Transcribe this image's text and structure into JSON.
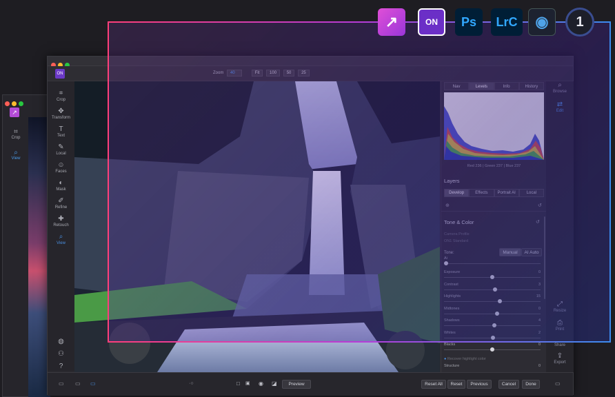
{
  "colors": {
    "accent": "#4a90e2",
    "overlay_border_start": "#ff3f7a",
    "overlay_border_end": "#3c8bf0"
  },
  "plugins": [
    {
      "name": "arrow-plugin-icon",
      "text": "↗"
    },
    {
      "name": "on1-plugin-icon",
      "text": "ON"
    },
    {
      "name": "photoshop-icon",
      "text": "Ps"
    },
    {
      "name": "lightroom-classic-icon",
      "text": "LrC"
    },
    {
      "name": "aperture-icon",
      "text": "◉"
    },
    {
      "name": "capture-one-icon",
      "text": "1"
    }
  ],
  "bg_window": {
    "tools": [
      {
        "label": "Crop",
        "icon": "crop-icon"
      },
      {
        "label": "View",
        "icon": "view-icon"
      }
    ]
  },
  "toolbar": {
    "zoom_label": "Zoom",
    "zoom_value": "40",
    "fit": "Fit",
    "z100": "100",
    "z50": "50",
    "z25": "25"
  },
  "tools": [
    {
      "label": "Crop"
    },
    {
      "label": "Transform"
    },
    {
      "label": "Text"
    },
    {
      "label": "Local"
    },
    {
      "label": "Faces"
    },
    {
      "label": "Mask"
    },
    {
      "label": "Refine"
    },
    {
      "label": "Retouch"
    },
    {
      "label": "View"
    }
  ],
  "panel": {
    "tabs": [
      "Nav",
      "Levels",
      "Info",
      "History"
    ],
    "rgb_readout": "Red 236 | Green 237 | Blue 237",
    "layers_title": "Layers",
    "subtabs": [
      "Develop",
      "Effects",
      "Portrait AI",
      "Local"
    ],
    "tone_title": "Tone & Color",
    "camera_profile": "Camera Profile",
    "profile_value": "ON1 Standard",
    "tone_label": "Tone:",
    "tone_manual": "Manual",
    "tone_ai": "AI Auto",
    "ai_label": "Ai ",
    "sliders": [
      {
        "label": "Exposure",
        "value": "0",
        "pos": 0.5
      },
      {
        "label": "Contrast",
        "value": "3",
        "pos": 0.53
      },
      {
        "label": "Highlights",
        "value": "15",
        "pos": 0.58
      },
      {
        "label": "Midtones",
        "value": "0",
        "pos": 0.55
      },
      {
        "label": "Shadows",
        "value": "4",
        "pos": 0.52
      },
      {
        "label": "Whites",
        "value": "2",
        "pos": 0.51
      },
      {
        "label": "Blacks",
        "value": "0",
        "pos": 0.5
      }
    ],
    "protect_label": "Recover highlight color",
    "structure_label": "Structure",
    "structure_value": "0"
  },
  "right_nav": [
    {
      "label": "Browse"
    },
    {
      "label": "Edit"
    },
    {
      "label": "Resize"
    },
    {
      "label": "Print"
    },
    {
      "label": "Share"
    },
    {
      "label": "Export"
    }
  ],
  "bottom": {
    "preview": "Preview",
    "reset_all": "Reset All",
    "reset": "Reset",
    "previous": "Previous",
    "cancel": "Cancel",
    "done": "Done"
  }
}
